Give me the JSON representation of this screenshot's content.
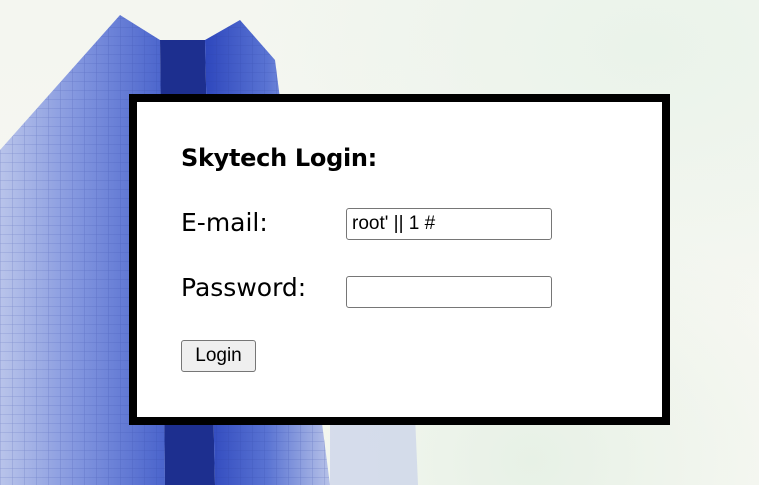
{
  "login": {
    "title": "Skytech Login:",
    "email_label": "E-mail:",
    "email_value": "root' || 1 #",
    "password_label": "Password:",
    "password_value": "",
    "submit_label": "Login"
  },
  "colors": {
    "card_border": "#000000",
    "card_background": "#ffffff",
    "button_background": "#efefef",
    "building_blue": "#3c55c8"
  }
}
